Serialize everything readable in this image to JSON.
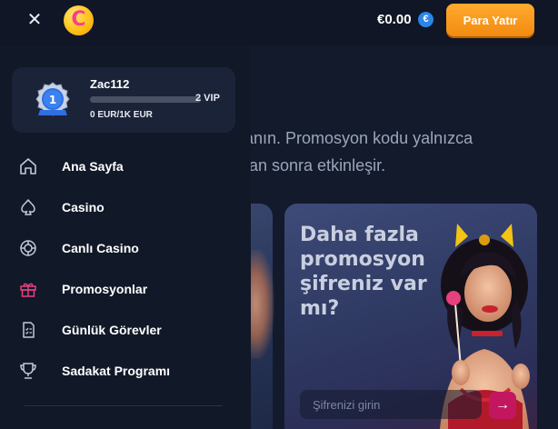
{
  "topbar": {
    "close_icon": "close-icon",
    "logo_letter": "C",
    "balance": "€0.00",
    "currency_badge": "€",
    "deposit_label": "Para Yatır"
  },
  "user": {
    "vip_badge_level": "1",
    "username": "Zac112",
    "vip_level": "2 VIP",
    "progress_text": "0 EUR/1K EUR",
    "progress_fraction": 0.0
  },
  "menu": {
    "items": [
      {
        "label": "Ana Sayfa",
        "icon": "home-icon"
      },
      {
        "label": "Casino",
        "icon": "spade-icon"
      },
      {
        "label": "Canlı Casino",
        "icon": "chip-icon"
      },
      {
        "label": "Promosyonlar",
        "icon": "gift-icon",
        "active": true
      },
      {
        "label": "Günlük Görevler",
        "icon": "task-list-icon"
      },
      {
        "label": "Sadakat Programı",
        "icon": "trophy-icon"
      }
    ]
  },
  "background": {
    "promo_text_line1": "anın. Promosyon kodu yalnızca",
    "promo_text_line2": "tan sonra etkinleşir.",
    "promo_card_title": "Daha fazla promosyon şifreniz var mı?",
    "code_input_placeholder": "Şifrenizi girin"
  },
  "colors": {
    "accent": "#f28a10",
    "active_icon": "#e6407f",
    "panel": "#111828",
    "card": "#1a2338"
  }
}
